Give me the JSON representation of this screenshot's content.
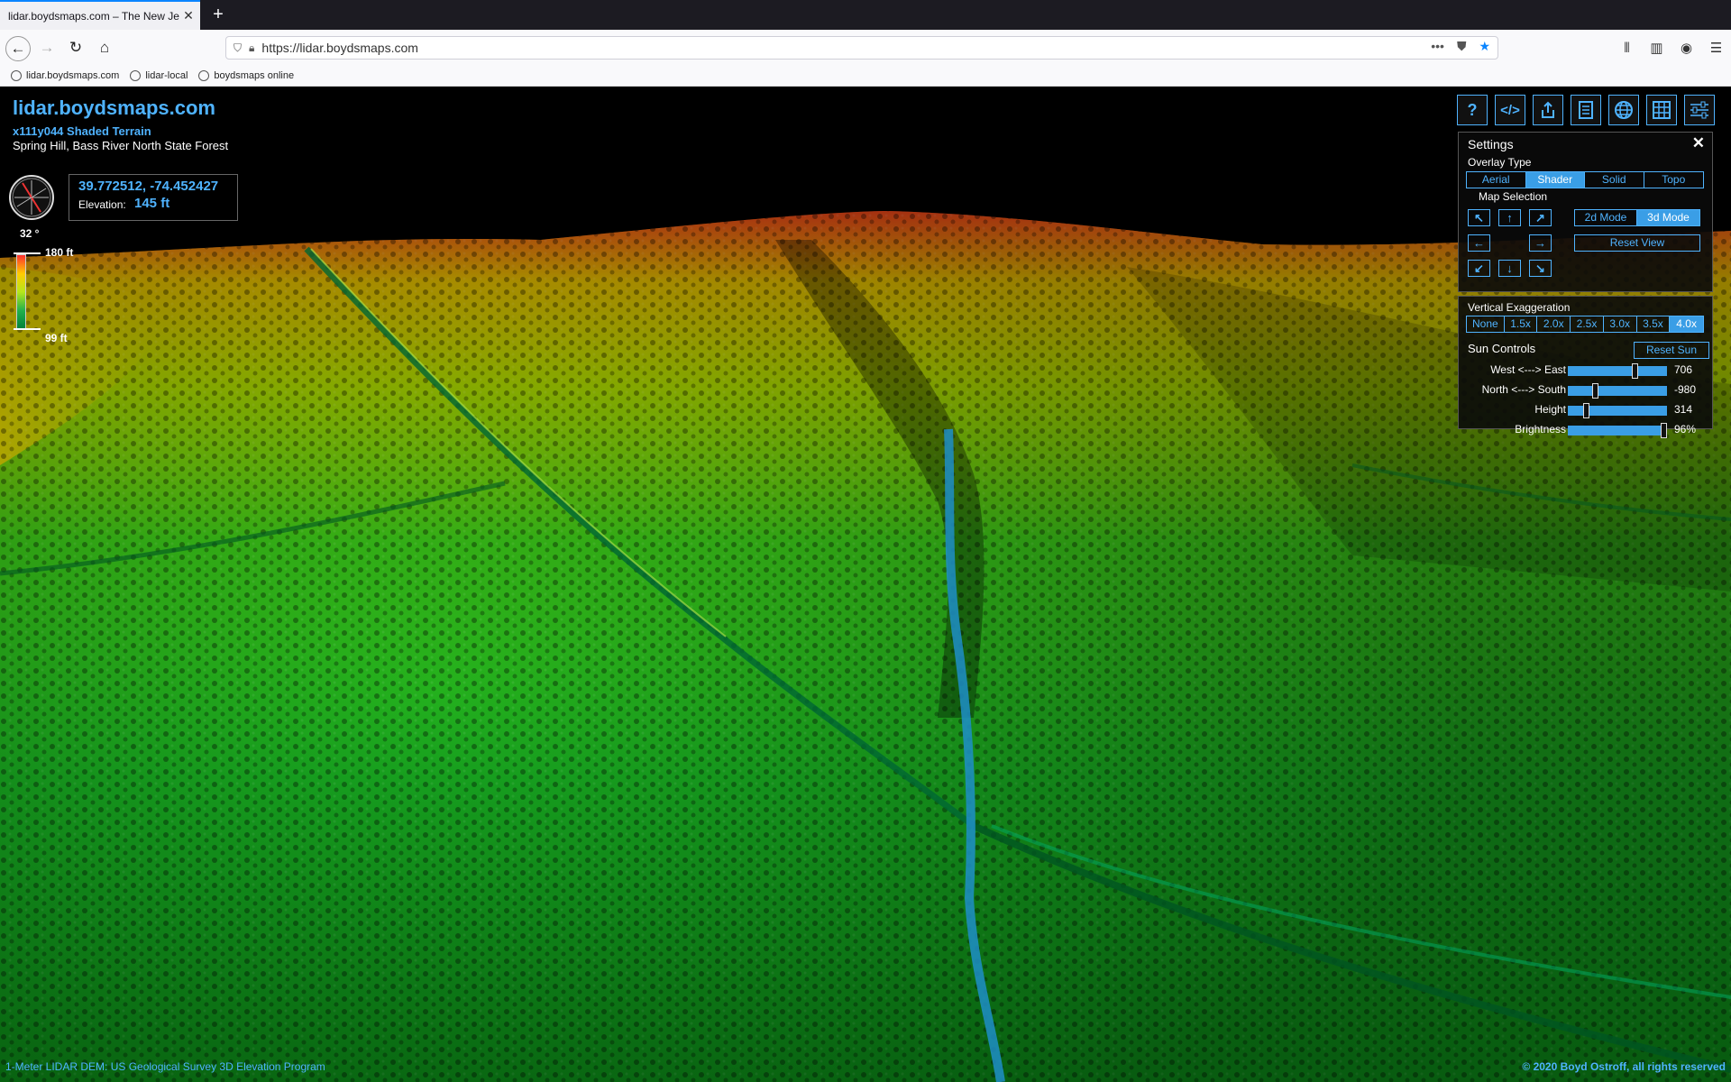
{
  "browser": {
    "tab_title": "lidar.boydsmaps.com – The New Je",
    "url": "https://lidar.boydsmaps.com",
    "bookmarks": [
      {
        "label": "lidar.boydsmaps.com"
      },
      {
        "label": "lidar-local"
      },
      {
        "label": "boydsmaps online"
      }
    ]
  },
  "map": {
    "site_title": "lidar.boydsmaps.com",
    "subtitle": "x111y044 Shaded Terrain",
    "location": "Spring Hill, Bass River North State Forest",
    "compass_heading": "32 °",
    "coordinates": "39.772512, -74.452427",
    "elevation_label": "Elevation:",
    "elevation_value": "145 ft",
    "legend_max": "180 ft",
    "legend_min": "99 ft",
    "footer_left": "1-Meter LIDAR DEM: US Geological Survey 3D Elevation Program",
    "footer_right": "© 2020 Boyd Ostroff, all rights reserved"
  },
  "toolbar_icons": [
    "help-icon",
    "code-icon",
    "share-icon",
    "document-icon",
    "globe-icon",
    "grid-icon",
    "settings-sliders-icon"
  ],
  "settings": {
    "title": "Settings",
    "overlay_type_label": "Overlay Type",
    "overlay_types": [
      "Aerial",
      "Shader",
      "Solid",
      "Topo"
    ],
    "overlay_selected": "Shader",
    "map_selection_label": "Map Selection",
    "modes": [
      "2d Mode",
      "3d Mode"
    ],
    "mode_selected": "3d Mode",
    "reset_view": "Reset View",
    "vertical_exaggeration_label": "Vertical Exaggeration",
    "exaggerations": [
      "None",
      "1.5x",
      "2.0x",
      "2.5x",
      "3.0x",
      "3.5x",
      "4.0x"
    ],
    "exaggeration_selected": "4.0x",
    "sun_controls_label": "Sun Controls",
    "reset_sun": "Reset Sun",
    "sliders": [
      {
        "label": "West <---> East",
        "value": "706",
        "fraction": 0.67
      },
      {
        "label": "North <---> South",
        "value": "-980",
        "fraction": 0.27
      },
      {
        "label": "Height",
        "value": "314",
        "fraction": 0.18
      },
      {
        "label": "Brightness",
        "value": "96%",
        "fraction": 0.96
      }
    ]
  },
  "colors": {
    "accent": "#4fb3ff",
    "active": "#3a9ee6"
  }
}
